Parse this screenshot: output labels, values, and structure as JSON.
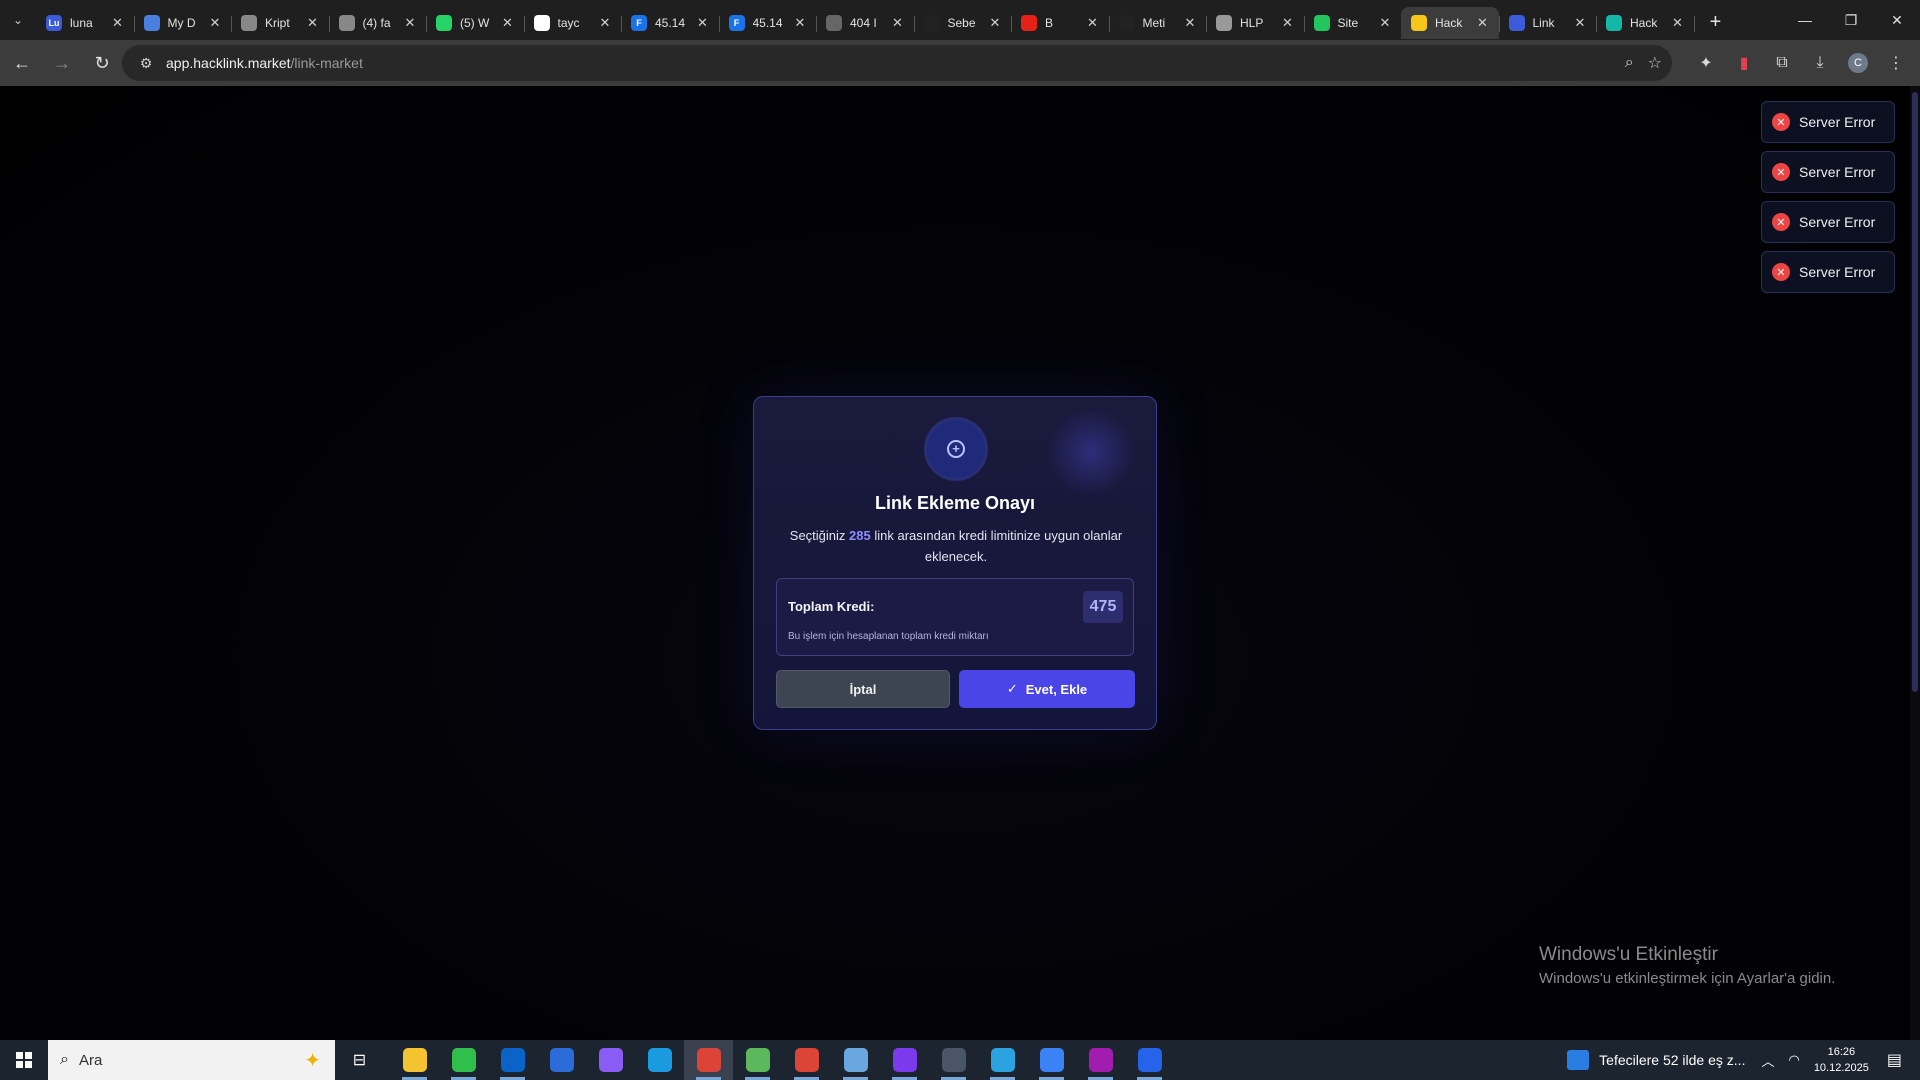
{
  "browser": {
    "tabs": [
      {
        "title": "luna",
        "favicon_text": "Lu",
        "color": "#3b5bdb"
      },
      {
        "title": "My D",
        "favicon_text": "",
        "color": "#4a7fe0"
      },
      {
        "title": "Kript",
        "favicon_text": "",
        "color": "#888888"
      },
      {
        "title": "(4) fa",
        "favicon_text": "",
        "color": "#888888"
      },
      {
        "title": "(5) W",
        "favicon_text": "",
        "color": "#25d366"
      },
      {
        "title": "tayc",
        "favicon_text": "G",
        "color": "#ffffff"
      },
      {
        "title": "45.14",
        "favicon_text": "F",
        "color": "#1a73e8"
      },
      {
        "title": "45.14",
        "favicon_text": "F",
        "color": "#1a73e8"
      },
      {
        "title": "404 I",
        "favicon_text": "",
        "color": "#666666"
      },
      {
        "title": "Sebe",
        "favicon_text": "",
        "color": "#222222"
      },
      {
        "title": "B",
        "favicon_text": "",
        "color": "#e62117"
      },
      {
        "title": "Meti",
        "favicon_text": "",
        "color": "#222222"
      },
      {
        "title": "HLP",
        "favicon_text": "",
        "color": "#999999"
      },
      {
        "title": "Site",
        "favicon_text": "",
        "color": "#22c55e"
      },
      {
        "title": "Hack",
        "favicon_text": "",
        "color": "#f5c518"
      },
      {
        "title": "Link",
        "favicon_text": "",
        "color": "#3b5bdb"
      },
      {
        "title": "Hack",
        "favicon_text": "",
        "color": "#14b8a6"
      }
    ],
    "active_tab_index": 14,
    "url_host": "app.hacklink.market",
    "url_path": "/link-market"
  },
  "toasts": [
    "Server Error",
    "Server Error",
    "Server Error",
    "Server Error"
  ],
  "modal": {
    "title": "Link Ekleme Onayı",
    "desc_before": "Seçtiğiniz ",
    "desc_count": "285",
    "desc_after": " link arasından kredi limitinize uygun olanlar eklenecek.",
    "credit_label": "Toplam Kredi:",
    "credit_value": "475",
    "credit_note": "Bu işlem için hesaplanan toplam kredi miktarı",
    "cancel_label": "İptal",
    "confirm_label": "Evet, Ekle"
  },
  "watermark": {
    "line1": "Windows'u Etkinleştir",
    "line2": "Windows'u etkinleştirmek için Ayarlar'a gidin."
  },
  "taskbar": {
    "search_placeholder": "Ara",
    "news": "Tefecilere 52 ilde eş z...",
    "time": "16:26",
    "date": "10.12.2025",
    "apps": [
      {
        "name": "file-explorer",
        "color": "#f4c430"
      },
      {
        "name": "app-green",
        "color": "#2fbf4a"
      },
      {
        "name": "outlook",
        "color": "#0a64c8"
      },
      {
        "name": "store",
        "color": "#2b6cd8"
      },
      {
        "name": "copilot",
        "color": "#8a5cf6"
      },
      {
        "name": "edge",
        "color": "#1a9be0"
      },
      {
        "name": "chrome",
        "color": "#db4437"
      },
      {
        "name": "notepad",
        "color": "#5cb85c"
      },
      {
        "name": "chrome-profile",
        "color": "#db4437"
      },
      {
        "name": "app-blue",
        "color": "#6aa6e0"
      },
      {
        "name": "app-purple",
        "color": "#7c3aed"
      },
      {
        "name": "calculator",
        "color": "#4a5568"
      },
      {
        "name": "telegram",
        "color": "#2aa3e0"
      },
      {
        "name": "app-network",
        "color": "#3b82f6"
      },
      {
        "name": "app-kocaeli",
        "color": "#a21caf"
      },
      {
        "name": "app-remote",
        "color": "#2563eb"
      }
    ],
    "active_app_index": 6
  }
}
